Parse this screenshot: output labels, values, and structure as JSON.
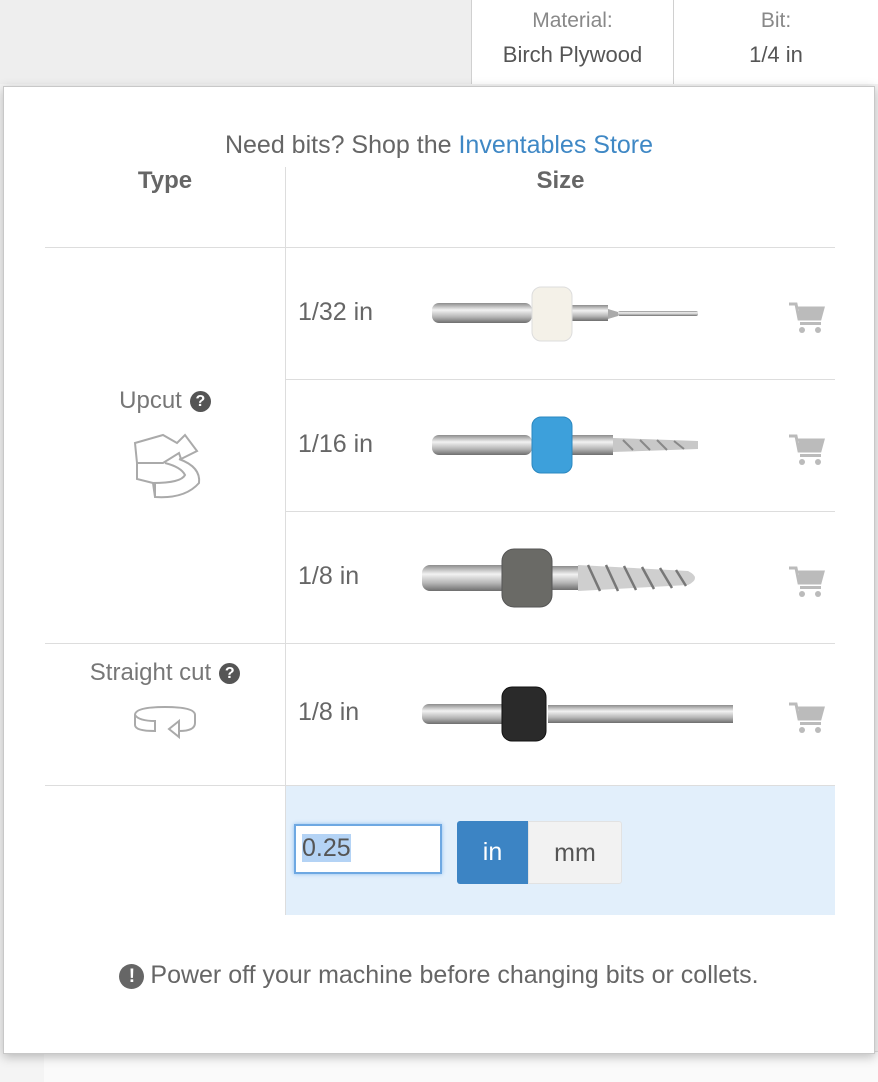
{
  "header": {
    "material_label": "Material:",
    "material_value": "Birch Plywood",
    "bit_label": "Bit:",
    "bit_value": "1/4 in"
  },
  "popup": {
    "shop_prefix": "Need bits? Shop the",
    "shop_link": "Inventables Store",
    "columns": {
      "type": "Type",
      "size": "Size"
    },
    "types": {
      "upcut": {
        "label": "Upcut",
        "help_icon": "question-circle-icon",
        "icon": "upcut-spiral-icon"
      },
      "straight": {
        "label": "Straight cut",
        "help_icon": "question-circle-icon",
        "icon": "straight-cut-icon"
      }
    },
    "bits": [
      {
        "size": "1/32 in",
        "type": "Upcut",
        "collar_color": "#f4f1e8",
        "cart_icon": "cart-icon"
      },
      {
        "size": "1/16 in",
        "type": "Upcut",
        "collar_color": "#3da0db",
        "cart_icon": "cart-icon"
      },
      {
        "size": "1/8 in",
        "type": "Upcut",
        "collar_color": "#6a6a66",
        "cart_icon": "cart-icon"
      },
      {
        "size": "1/8 in",
        "type": "Straight cut",
        "collar_color": "#2a2a2a",
        "cart_icon": "cart-icon"
      }
    ],
    "custom": {
      "value": "0.25",
      "unit_in": "in",
      "unit_mm": "mm",
      "selected_unit": "in"
    },
    "warning": "Power off your machine before changing bits or collets.",
    "accent_color": "#3c84c4",
    "link_color": "#3f88c5"
  }
}
